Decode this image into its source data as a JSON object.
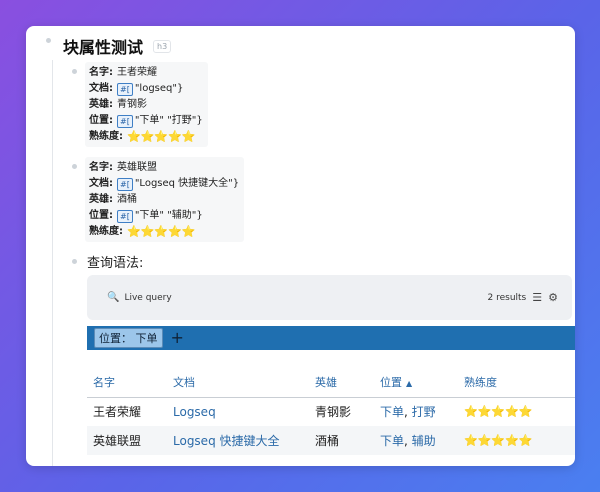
{
  "page": {
    "heading": "块属性测试",
    "heading_tag": "h3"
  },
  "blocks": [
    {
      "name_key": "名字:",
      "name_val": "王者荣耀",
      "doc_key": "文档:",
      "doc_pill": "#[",
      "doc_val": "\"logseq\"}",
      "hero_key": "英雄:",
      "hero_val": "青钢影",
      "pos_key": "位置:",
      "pos_pill": "#[",
      "pos_val": "\"下单\" \"打野\"}",
      "skill_key": "熟练度:",
      "skill_stars": "⭐⭐⭐⭐⭐"
    },
    {
      "name_key": "名字:",
      "name_val": "英雄联盟",
      "doc_key": "文档:",
      "doc_pill": "#[",
      "doc_val": "\"Logseq 快捷键大全\"}",
      "hero_key": "英雄:",
      "hero_val": "酒桶",
      "pos_key": "位置:",
      "pos_pill": "#[",
      "pos_val": "\"下单\" \"辅助\"}",
      "skill_key": "熟练度:",
      "skill_stars": "⭐⭐⭐⭐⭐"
    }
  ],
  "query": {
    "label": "查询语法:",
    "search_icon": "🔍",
    "live_label": "Live query",
    "results": "2 results",
    "list_icon": "☰",
    "settings_icon": "⚙",
    "filter_chip": "位置： 下单",
    "add_icon": "+"
  },
  "table": {
    "headers": [
      "名字",
      "文档",
      "英雄",
      "位置",
      "熟练度"
    ],
    "sort_icon": "▲",
    "rows": [
      {
        "name": "王者荣耀",
        "doc": "Logseq",
        "hero": "青钢影",
        "pos1": "下单",
        "pos_sep": ",",
        "pos2": "打野",
        "skill": "⭐⭐⭐⭐⭐"
      },
      {
        "name": "英雄联盟",
        "doc": "Logseq 快捷键大全",
        "hero": "酒桶",
        "pos1": "下单",
        "pos_sep": ",",
        "pos2": "辅助",
        "skill": "⭐⭐⭐⭐⭐"
      }
    ]
  }
}
